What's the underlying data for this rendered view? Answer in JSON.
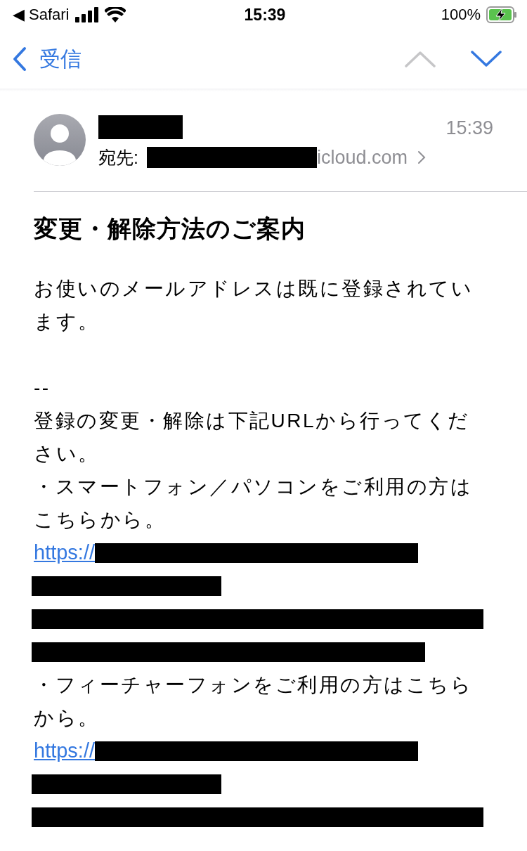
{
  "status_bar": {
    "back_app": "◀ Safari",
    "time": "15:39",
    "battery": "100%"
  },
  "nav": {
    "back": "受信",
    "prev_enabled": false,
    "next_enabled": true
  },
  "header": {
    "to_label": "宛先:",
    "to_suffix": "icloud.com",
    "time": "15:39"
  },
  "subject": "変更・解除方法のご案内",
  "body": [
    {
      "kind": "paragraph",
      "lines": [
        "お使いのメールアドレスは既に登録されてい",
        "ます。"
      ]
    },
    {
      "kind": "blank"
    },
    {
      "kind": "paragraph",
      "lines": [
        "--"
      ]
    },
    {
      "kind": "paragraph",
      "lines": [
        "登録の変更・解除は下記URLから行ってくだ",
        "さい。"
      ]
    },
    {
      "kind": "paragraph",
      "lines": [
        "・スマートフォン／パソコンをご利用の方は",
        "こちらから。"
      ]
    },
    {
      "kind": "link",
      "text": "https://"
    },
    {
      "kind": "redacted"
    },
    {
      "kind": "redacted"
    },
    {
      "kind": "redacted"
    },
    {
      "kind": "paragraph",
      "lines": [
        "・フィーチャーフォンをご利用の方はこちら",
        "から。"
      ]
    },
    {
      "kind": "link",
      "text": "https://"
    },
    {
      "kind": "redacted"
    },
    {
      "kind": "redacted"
    }
  ]
}
